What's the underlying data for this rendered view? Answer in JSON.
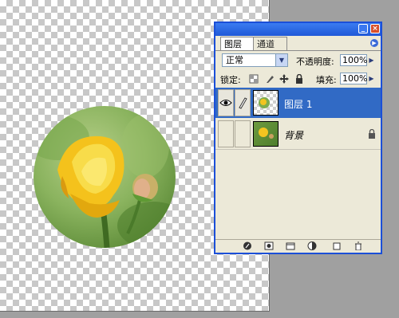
{
  "panel": {
    "tabs": [
      {
        "label": "图层"
      },
      {
        "label": "通道"
      }
    ],
    "blend_mode": "正常",
    "opacity_label": "不透明度:",
    "opacity_value": "100%",
    "lock_label": "锁定:",
    "fill_label": "填充:",
    "fill_value": "100%",
    "layers": [
      {
        "name": "图层 1",
        "selected": true
      },
      {
        "name": "背景",
        "selected": false,
        "locked": true
      }
    ],
    "bottom_icons": [
      "link-icon",
      "layer-style-icon",
      "mask-icon",
      "folder-icon",
      "adjustment-icon",
      "new-layer-icon",
      "trash-icon"
    ]
  },
  "colors": {
    "titlebar": "#2a62e0",
    "selection": "#316ac5",
    "panel_bg": "#ece9d8"
  }
}
